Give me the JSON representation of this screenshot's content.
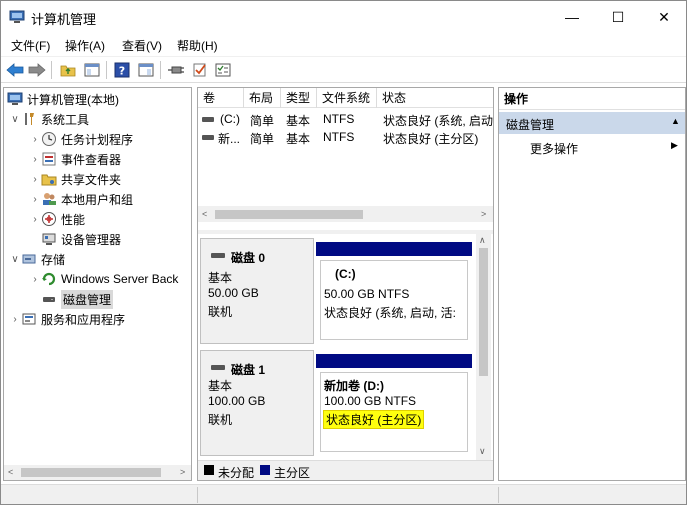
{
  "window": {
    "title": "计算机管理",
    "controls": {
      "minimize": "—",
      "maximize": "☐",
      "close": "✕"
    }
  },
  "menu": [
    "文件(F)",
    "操作(A)",
    "查看(V)",
    "帮助(H)"
  ],
  "tree": {
    "root": "计算机管理(本地)",
    "items": [
      {
        "label": "系统工具",
        "icon": "tools-icon",
        "level": 1,
        "expanded": true
      },
      {
        "label": "任务计划程序",
        "icon": "clock-icon",
        "level": 2
      },
      {
        "label": "事件查看器",
        "icon": "event-viewer-icon",
        "level": 2
      },
      {
        "label": "共享文件夹",
        "icon": "shared-folder-icon",
        "level": 2
      },
      {
        "label": "本地用户和组",
        "icon": "users-icon",
        "level": 2
      },
      {
        "label": "性能",
        "icon": "performance-icon",
        "level": 2
      },
      {
        "label": "设备管理器",
        "icon": "device-manager-icon",
        "level": 2
      },
      {
        "label": "存储",
        "icon": "storage-icon",
        "level": 1,
        "expanded": true
      },
      {
        "label": "Windows Server Back",
        "icon": "backup-icon",
        "level": 2
      },
      {
        "label": "磁盘管理",
        "icon": "disk-management-icon",
        "level": 2,
        "selected": true
      },
      {
        "label": "服务和应用程序",
        "icon": "services-icon",
        "level": 1
      }
    ]
  },
  "volume_list": {
    "columns": [
      "卷",
      "布局",
      "类型",
      "文件系统",
      "状态"
    ],
    "rows": [
      {
        "name": "(C:)",
        "layout": "简单",
        "type": "基本",
        "fs": "NTFS",
        "status": "状态良好 (系统, 启动"
      },
      {
        "name": "新...",
        "layout": "简单",
        "type": "基本",
        "fs": "NTFS",
        "status": "状态良好 (主分区)"
      }
    ]
  },
  "disks": [
    {
      "name": "磁盘 0",
      "type": "基本",
      "size": "50.00 GB",
      "state": "联机",
      "partition": {
        "label": "(C:)",
        "size_fs": "50.00 GB NTFS",
        "status": "状态良好 (系统, 启动, 活:"
      }
    },
    {
      "name": "磁盘 1",
      "type": "基本",
      "size": "100.00 GB",
      "state": "联机",
      "partition": {
        "label": "新加卷  (D:)",
        "size_fs": "100.00 GB NTFS",
        "status": "状态良好 (主分区)"
      }
    }
  ],
  "legend": [
    {
      "label": "未分配",
      "color": "#000000"
    },
    {
      "label": "主分区",
      "color": "#000a83"
    }
  ],
  "actions": {
    "header": "操作",
    "section": "磁盘管理",
    "more": "更多操作"
  },
  "colors": {
    "primary_partition": "#000a83",
    "selection_highlight": "#cad8ea",
    "status_highlight": "#ffff0f"
  }
}
